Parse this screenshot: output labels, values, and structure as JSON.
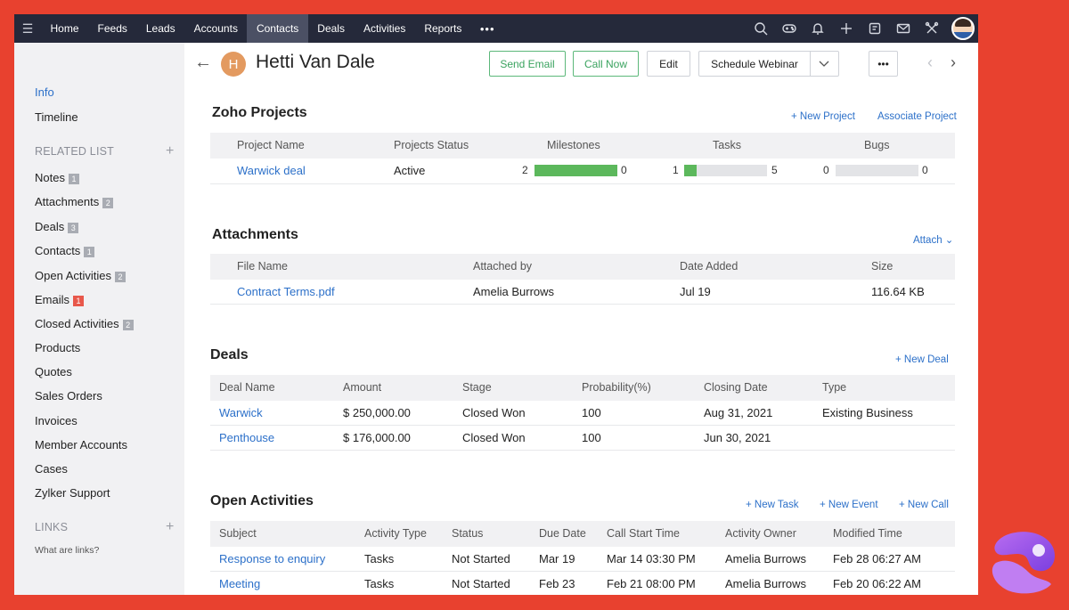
{
  "nav": {
    "tabs": [
      "Home",
      "Feeds",
      "Leads",
      "Accounts",
      "Contacts",
      "Deals",
      "Activities",
      "Reports"
    ],
    "active_tab": "Contacts",
    "more": "•••"
  },
  "sidebar": {
    "info": "Info",
    "timeline": "Timeline",
    "related_list_heading": "RELATED LIST",
    "related_items": [
      {
        "label": "Notes",
        "badge": "1"
      },
      {
        "label": "Attachments",
        "badge": "2"
      },
      {
        "label": "Deals",
        "badge": "3"
      },
      {
        "label": "Contacts",
        "badge": "1"
      },
      {
        "label": "Open Activities",
        "badge": "2"
      },
      {
        "label": "Emails",
        "badge": "1"
      },
      {
        "label": "Closed Activities",
        "badge": "2"
      },
      {
        "label": "Products"
      },
      {
        "label": "Quotes"
      },
      {
        "label": "Sales Orders"
      },
      {
        "label": "Invoices"
      },
      {
        "label": "Member Accounts"
      },
      {
        "label": "Cases"
      },
      {
        "label": "Zylker Support"
      }
    ],
    "links_heading": "LINKS",
    "links_help": "What are links?"
  },
  "header": {
    "avatar_initial": "H",
    "name": "Hetti Van Dale",
    "send_email": "Send Email",
    "call_now": "Call Now",
    "edit": "Edit",
    "schedule_webinar": "Schedule Webinar",
    "more": "•••"
  },
  "projects": {
    "title": "Zoho Projects",
    "new_project": "+ New Project",
    "associate_project": "Associate Project",
    "columns": [
      "Project Name",
      "Projects Status",
      "Milestones",
      "Tasks",
      "Bugs"
    ],
    "rows": [
      {
        "name": "Warwick deal",
        "status": "Active",
        "milestones": {
          "done": "2",
          "remaining": "0",
          "progress": 1.0
        },
        "tasks": {
          "done": "1",
          "total": "5",
          "progress": 0.15
        },
        "bugs": {
          "done": "0",
          "total": "0",
          "progress": 0
        }
      }
    ]
  },
  "attachments": {
    "title": "Attachments",
    "attach": "Attach",
    "columns": [
      "File Name",
      "Attached by",
      "Date Added",
      "Size"
    ],
    "rows": [
      {
        "file": "Contract Terms.pdf",
        "by": "Amelia Burrows",
        "date": "Jul 19",
        "size": "116.64 KB"
      }
    ]
  },
  "deals": {
    "title": "Deals",
    "new_deal": "+ New Deal",
    "columns": [
      "Deal Name",
      "Amount",
      "Stage",
      "Probability(%)",
      "Closing Date",
      "Type"
    ],
    "rows": [
      {
        "name": "Warwick",
        "amount": "$ 250,000.00",
        "stage": "Closed Won",
        "prob": "100",
        "closing": "Aug 31, 2021",
        "type": "Existing Business"
      },
      {
        "name": "Penthouse",
        "amount": "$ 176,000.00",
        "stage": "Closed Won",
        "prob": "100",
        "closing": "Jun 30, 2021",
        "type": ""
      }
    ]
  },
  "activities": {
    "title": "Open Activities",
    "new_task": "+ New Task",
    "new_event": "+ New Event",
    "new_call": "+ New Call",
    "columns": [
      "Subject",
      "Activity Type",
      "Status",
      "Due Date",
      "Call Start Time",
      "Activity Owner",
      "Modified Time"
    ],
    "rows": [
      {
        "subject": "Response to enquiry",
        "type": "Tasks",
        "status": "Not Started",
        "due": "Mar 19",
        "call_start": "Mar 14 03:30 PM",
        "owner": "Amelia Burrows",
        "modified": "Feb 28 06:27 AM"
      },
      {
        "subject": "Meeting",
        "type": "Tasks",
        "status": "Not Started",
        "due": "Feb 23",
        "call_start": "Feb 21 08:00 PM",
        "owner": "Amelia Burrows",
        "modified": "Feb 20 06:22 AM"
      }
    ]
  },
  "colors": {
    "frame": "#e8412f",
    "nav_bg": "#25293a",
    "link": "#2c70c9",
    "progress": "#5cb85c"
  }
}
